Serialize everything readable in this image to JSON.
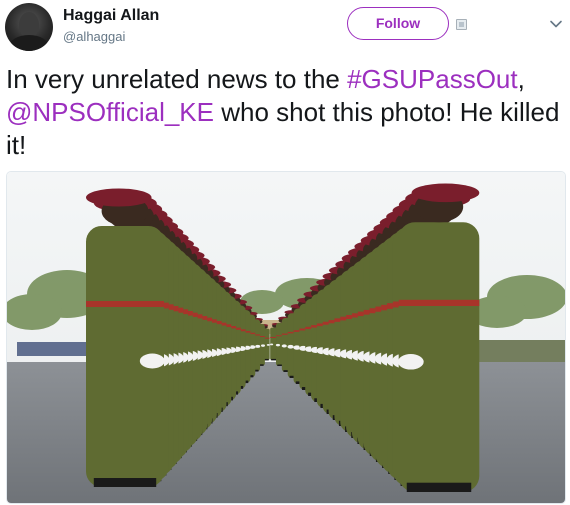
{
  "author": {
    "display_name": "Haggai Allan",
    "handle": "@alhaggai",
    "avatar_icon": "user-avatar"
  },
  "actions": {
    "follow_label": "Follow",
    "menu_icon": "chevron-down-icon",
    "extra_icon": "image-placeholder-icon"
  },
  "tweet": {
    "text_before": "In very unrelated news to the ",
    "hashtag": "#GSUPassOut",
    "text_middle": ", ",
    "mention": "@NPSOfficial_KE",
    "text_after": " who shot this photo! He killed it!",
    "link_color": "#9c2fbf"
  },
  "media": {
    "photo_icon": "photo-soldiers-parade"
  }
}
